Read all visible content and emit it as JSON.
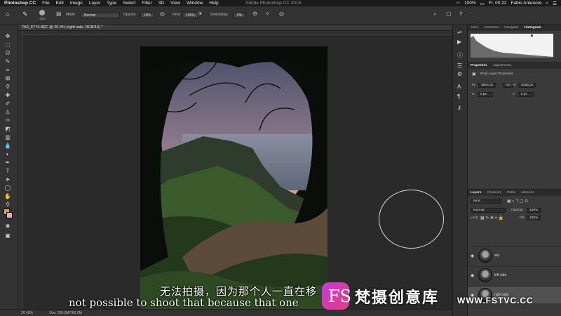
{
  "menubar": {
    "items": [
      "Photoshop CC",
      "File",
      "Edit",
      "Image",
      "Layer",
      "Type",
      "Select",
      "Filter",
      "3D",
      "View",
      "Window",
      "Help"
    ],
    "window_title": "Adobe Photoshop CC 2019",
    "battery": "100%",
    "clock": "Fr. 00:22",
    "user": "Fabio Antenore"
  },
  "options": {
    "brush_size": "1000",
    "mode_label": "Mode:",
    "mode_value": "Normal",
    "opacity_label": "Opacity:",
    "opacity_value": "10%",
    "flow_label": "Flow:",
    "flow_value": "100%",
    "smoothing_label": "Smoothing:",
    "smoothing_value": "0%"
  },
  "document": {
    "tab": "FA2_6774.NEF @ 20.4% (right side, RGB/16) *",
    "zoom": "20.45%",
    "doc_size": "Doc: 260.0M/780.0M"
  },
  "panels": {
    "top_tabs": [
      "Color",
      "Swatches",
      "Navigator",
      "Histogram"
    ],
    "props_tabs": [
      "Properties",
      "Adjustments"
    ],
    "props_title": "Pixel Layer Properties",
    "w_label": "W:",
    "w_value": "5504 px",
    "go_label": "GO",
    "h_label": "H:",
    "h_value": "8256 px",
    "x_label": "X:",
    "x_value": "0 px",
    "y_label": "Y:",
    "y_value": "0 px"
  },
  "layers_panel": {
    "tabs": [
      "Layers",
      "Channels",
      "Paths",
      "Libraries"
    ],
    "kind": "Kind",
    "blend_mode": "Normal",
    "opacity_label": "Opacity:",
    "opacity_value": "100%",
    "lock_label": "Lock:",
    "fill_label": "Fill:",
    "fill_value": "100%",
    "layers": [
      {
        "name": "sky"
      },
      {
        "name": "left side"
      },
      {
        "name": "right side"
      }
    ]
  },
  "subtitles": {
    "chinese": "无法拍摄，因为那个人一直在移",
    "english": "not possible to shoot that because that one"
  },
  "watermark": {
    "logo": "FS",
    "name": "梵摄创意库",
    "url": "WWW.FSTVC.CC"
  },
  "colors": {
    "foreground": "#d9a94e",
    "background": "#e7a6c8",
    "accent": "#c23bd6"
  }
}
